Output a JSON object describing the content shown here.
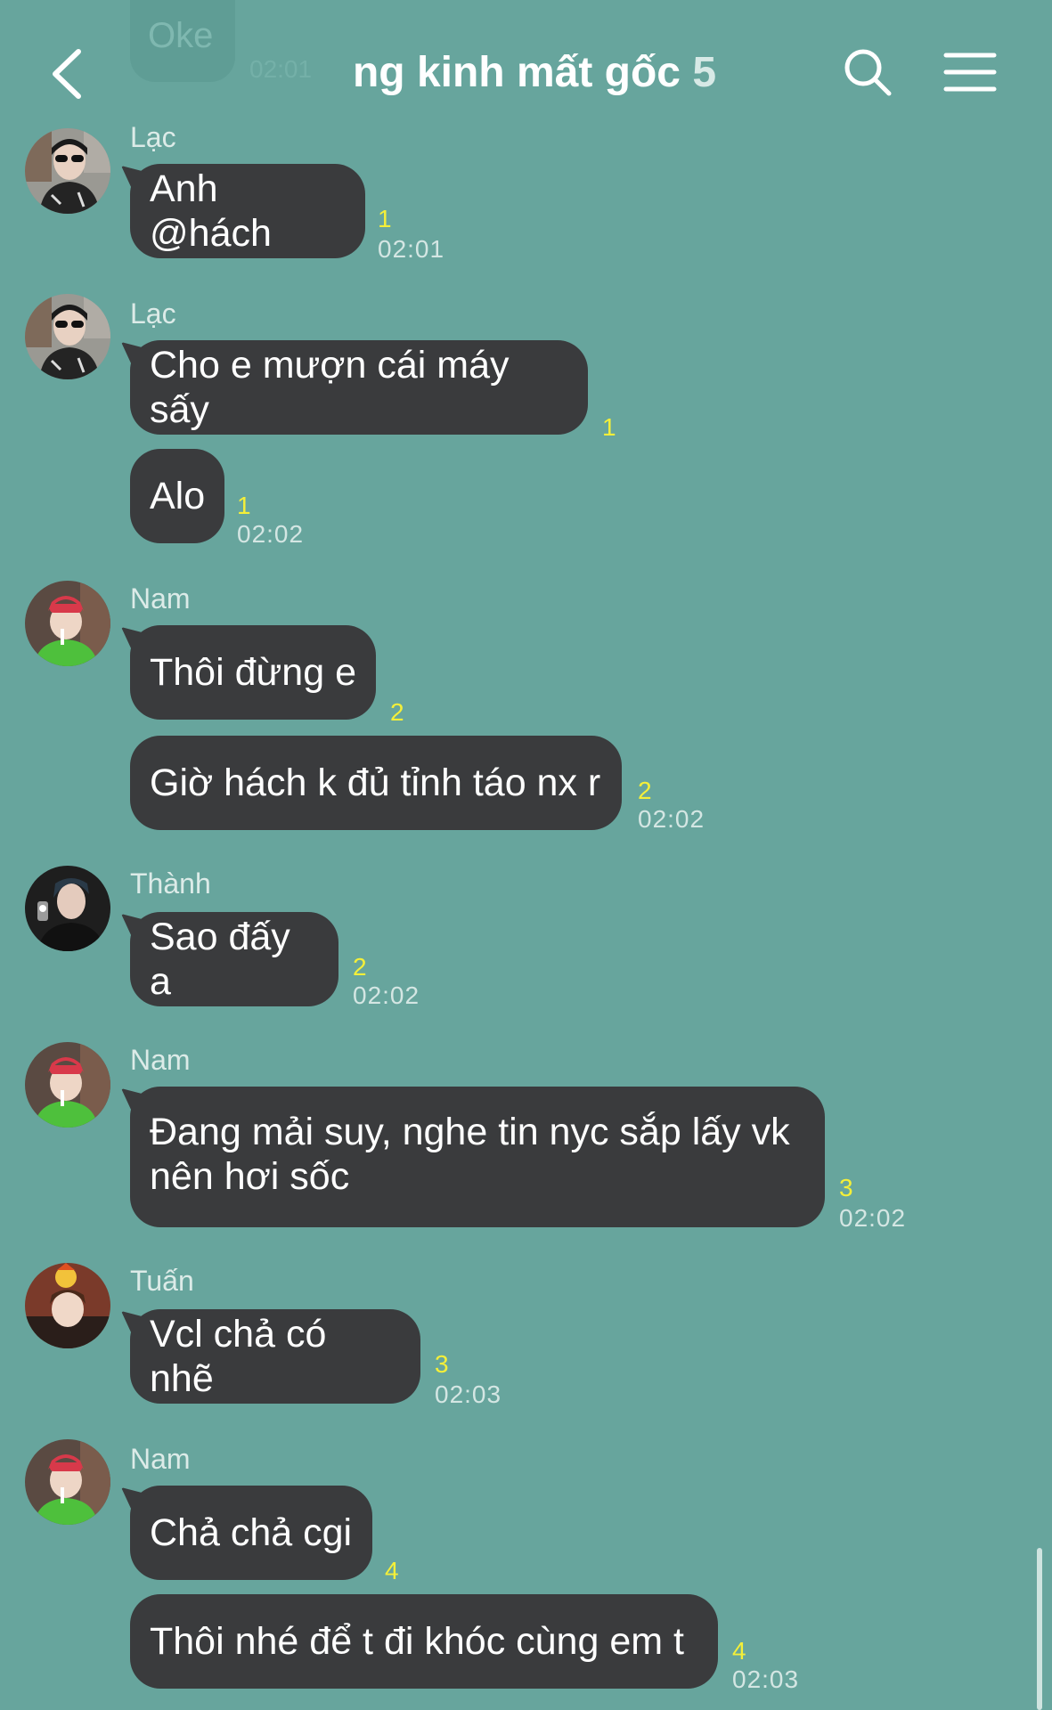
{
  "header": {
    "title": "ng kinh mất gốc",
    "member_count": "5",
    "back_icon": "chevron-left-icon",
    "search_icon": "search-icon",
    "menu_icon": "hamburger-menu-icon"
  },
  "previous_message": {
    "text": "Oke",
    "time": "02:01"
  },
  "colors": {
    "background": "#67a59d",
    "bubble": "#3a3b3d",
    "read_count": "#f4ef39"
  },
  "messages": [
    {
      "sender": "Lạc",
      "text": "Anh @hách",
      "read": "1",
      "time": "02:01"
    },
    {
      "sender": "Lạc",
      "text": "Cho e mượn cái máy sấy",
      "read": "1",
      "time": ""
    },
    {
      "sender": "",
      "text": "Alo",
      "read": "1",
      "time": "02:02"
    },
    {
      "sender": "Nam",
      "text": "Thôi đừng e",
      "read": "2",
      "time": ""
    },
    {
      "sender": "",
      "text": "Giờ hách k đủ tỉnh táo nx r",
      "read": "2",
      "time": "02:02"
    },
    {
      "sender": "Thành",
      "text": "Sao đấy a",
      "read": "2",
      "time": "02:02"
    },
    {
      "sender": "Nam",
      "text": "Đang mải suy, nghe tin nyc sắp lấy vk nên hơi sốc",
      "read": "3",
      "time": "02:02"
    },
    {
      "sender": "Tuấn",
      "text": "Vcl chả có nhẽ",
      "read": "3",
      "time": "02:03"
    },
    {
      "sender": "Nam",
      "text": "Chả chả cgi",
      "read": "4",
      "time": ""
    },
    {
      "sender": "",
      "text": "Thôi nhé để t đi khóc cùng em t",
      "read": "4",
      "time": "02:03"
    }
  ]
}
